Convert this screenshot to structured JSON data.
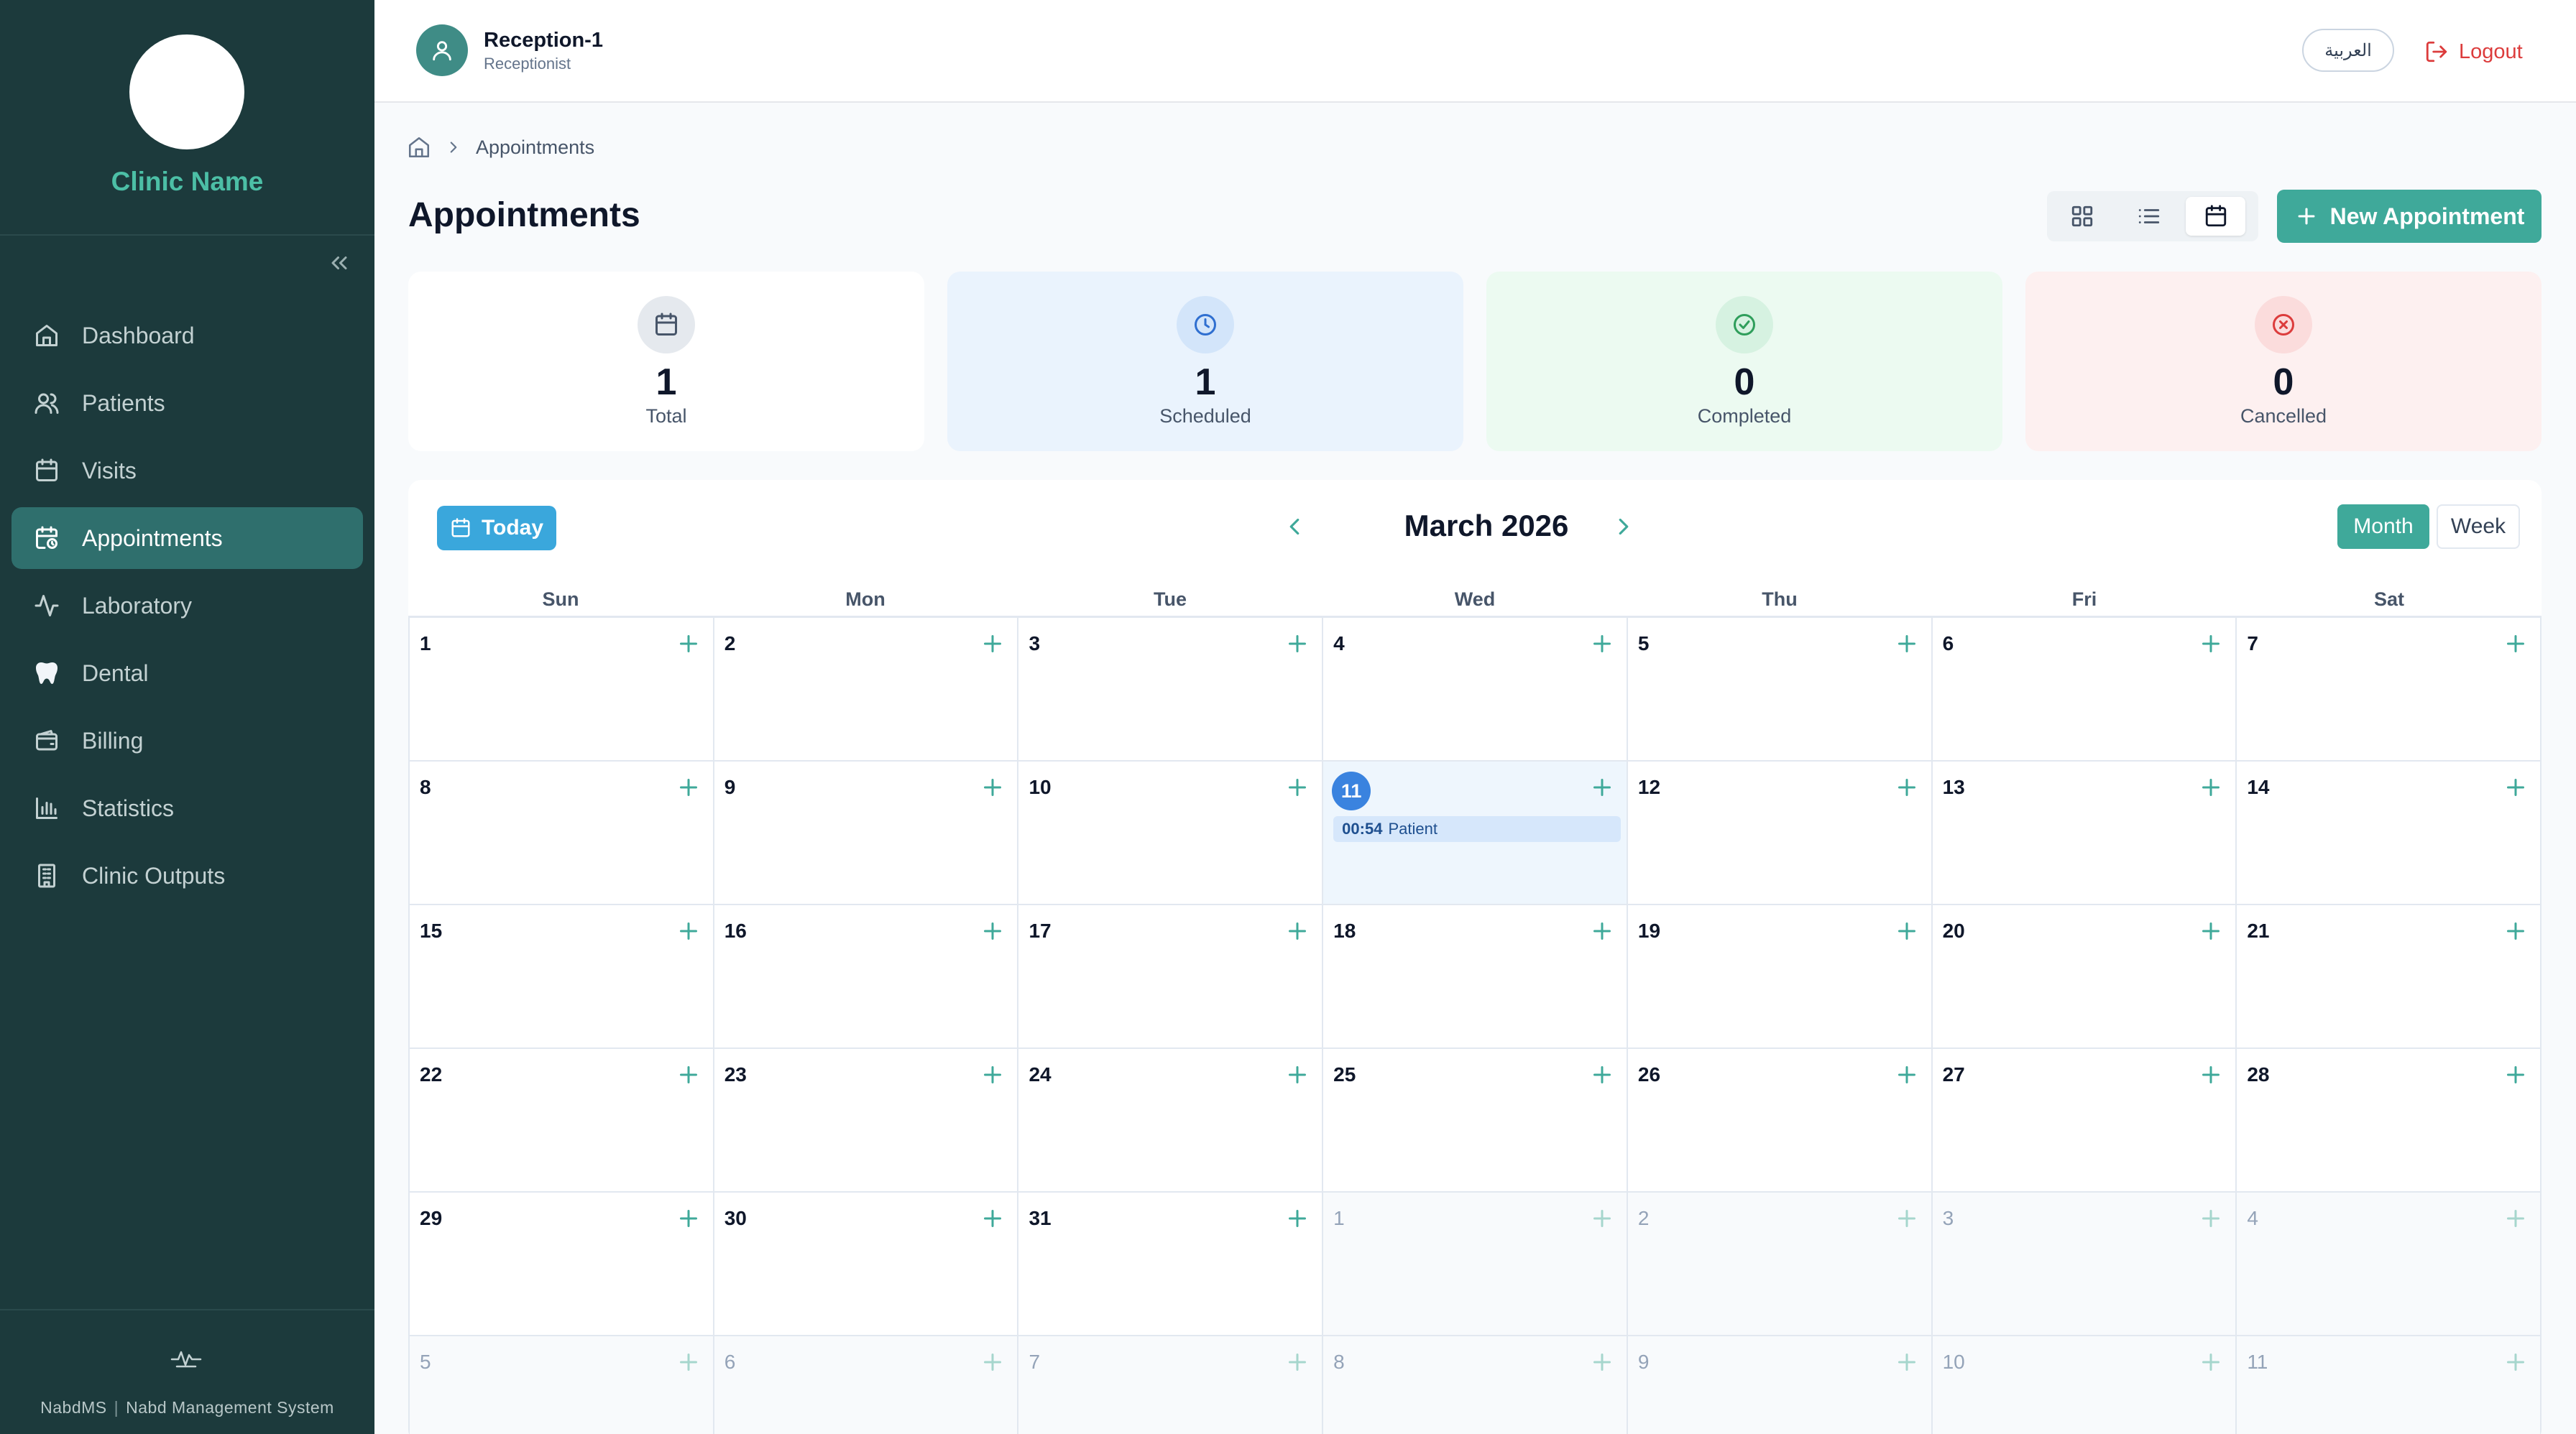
{
  "sidebar": {
    "clinic_name": "Clinic Name",
    "nav": [
      {
        "label": "Dashboard",
        "icon": "home-icon"
      },
      {
        "label": "Patients",
        "icon": "users-icon"
      },
      {
        "label": "Visits",
        "icon": "calendar-icon"
      },
      {
        "label": "Appointments",
        "icon": "calendar-clock-icon",
        "active": true
      },
      {
        "label": "Laboratory",
        "icon": "activity-icon"
      },
      {
        "label": "Dental",
        "icon": "tooth-icon"
      },
      {
        "label": "Billing",
        "icon": "wallet-icon"
      },
      {
        "label": "Statistics",
        "icon": "bar-chart-icon"
      },
      {
        "label": "Clinic Outputs",
        "icon": "building-icon"
      }
    ],
    "footer_brand": "NabdMS",
    "footer_sep": "|",
    "footer_text": "Nabd Management System"
  },
  "topbar": {
    "user_name": "Reception-1",
    "user_role": "Receptionist",
    "lang_label": "العربية",
    "logout_label": "Logout"
  },
  "breadcrumb": {
    "current": "Appointments"
  },
  "header": {
    "title": "Appointments",
    "new_button": "New Appointment"
  },
  "stats": [
    {
      "value": "1",
      "label": "Total"
    },
    {
      "value": "1",
      "label": "Scheduled"
    },
    {
      "value": "0",
      "label": "Completed"
    },
    {
      "value": "0",
      "label": "Cancelled"
    }
  ],
  "calendar": {
    "today_label": "Today",
    "month_label": "March 2026",
    "view_month": "Month",
    "view_week": "Week",
    "weekdays": [
      "Sun",
      "Mon",
      "Tue",
      "Wed",
      "Thu",
      "Fri",
      "Sat"
    ],
    "weeks": [
      [
        "1",
        "2",
        "3",
        "4",
        "5",
        "6",
        "7"
      ],
      [
        "8",
        "9",
        "10",
        "11",
        "12",
        "13",
        "14"
      ],
      [
        "15",
        "16",
        "17",
        "18",
        "19",
        "20",
        "21"
      ],
      [
        "22",
        "23",
        "24",
        "25",
        "26",
        "27",
        "28"
      ],
      [
        "29",
        "30",
        "31",
        "1",
        "2",
        "3",
        "4"
      ],
      [
        "5",
        "6",
        "7",
        "8",
        "9",
        "10",
        "11"
      ]
    ],
    "today_day": "11",
    "event": {
      "time": "00:54",
      "title": "Patient"
    }
  },
  "colors": {
    "sidebar_bg": "#1c3a3c",
    "accent": "#3fa99a",
    "clinic_name": "#4cbfa6",
    "today_blue": "#3a83df",
    "logout_red": "#dc3c3c"
  }
}
